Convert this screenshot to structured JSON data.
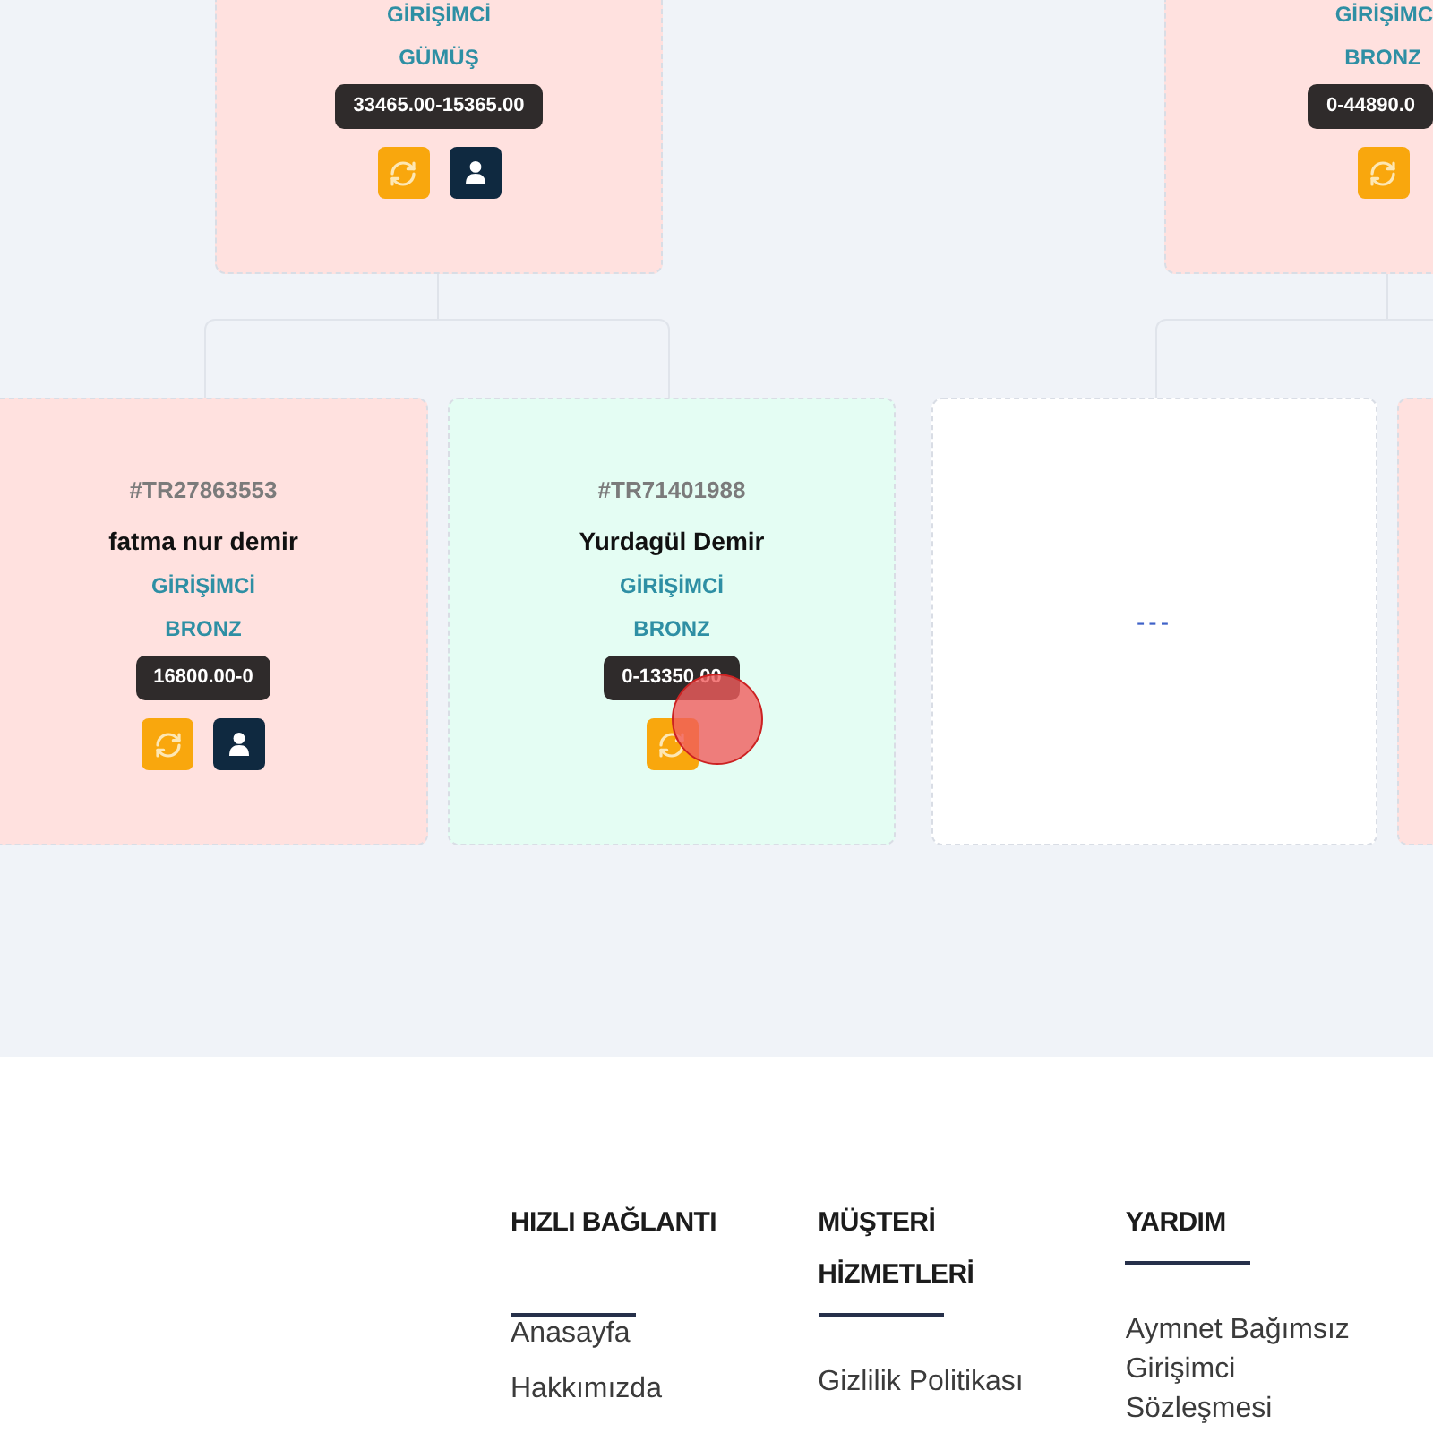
{
  "tree": {
    "top_row": [
      {
        "kind": "member",
        "color": "#ffe1df",
        "title": "GİRİŞİMCİ",
        "tier": "GÜMÜŞ",
        "range": "33465.00-15365.00",
        "buttons": [
          {
            "kind": "refresh"
          },
          {
            "kind": "profile"
          }
        ]
      },
      {
        "kind": "member",
        "color": "#ffe1df",
        "title": "GİRİŞİMC",
        "tier": "BRONZ",
        "range": "0-44890.0",
        "buttons": [
          {
            "kind": "refresh"
          }
        ]
      }
    ],
    "bottom_row": [
      {
        "kind": "member",
        "color": "#ffe1df",
        "id": "#TR27863553",
        "name": "fatma nur demir",
        "title": "GİRİŞİMCİ",
        "tier": "BRONZ",
        "range": "16800.00-0",
        "buttons": [
          {
            "kind": "refresh"
          },
          {
            "kind": "profile"
          }
        ]
      },
      {
        "kind": "member",
        "color": "#e4fdf3",
        "id": "#TR71401988",
        "name": "Yurdagül Demir",
        "title": "GİRİŞİMCİ",
        "tier": "BRONZ",
        "range": "0-13350.00",
        "buttons": [
          {
            "kind": "refresh"
          }
        ]
      },
      {
        "kind": "empty",
        "label": "---"
      },
      {
        "kind": "member",
        "color": "#ffe1df"
      }
    ]
  },
  "footer": {
    "columns": [
      {
        "heading": "HIZLI BAĞLANTI",
        "links": [
          "Anasayfa",
          "Hakkımızda"
        ]
      },
      {
        "heading": "MÜŞTERİ HİZMETLERİ",
        "links": [
          "Gizlilik Politikası"
        ]
      },
      {
        "heading": "YARDIM",
        "links": [
          "Aymnet Bağımsız Girişimci Sözleşmesi"
        ]
      }
    ]
  }
}
